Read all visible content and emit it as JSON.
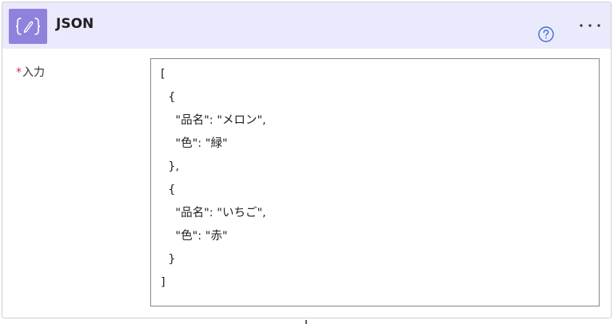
{
  "header": {
    "title": "JSON",
    "icon": "json-curly-braces-icon",
    "accent_color": "#8f82dd",
    "background_color": "#ebe9fc",
    "help_icon": "help-circle-icon",
    "more_icon": "more-ellipsis-icon"
  },
  "form": {
    "input_label": "入力",
    "required_mark": "*",
    "code_lines": [
      "[",
      "  {",
      "    \"品名\": \"メロン\",",
      "    \"色\": \"緑\"",
      "  },",
      "  {",
      "    \"品名\": \"いちご\",",
      "    \"色\": \"赤\"",
      "  }",
      "]"
    ]
  }
}
